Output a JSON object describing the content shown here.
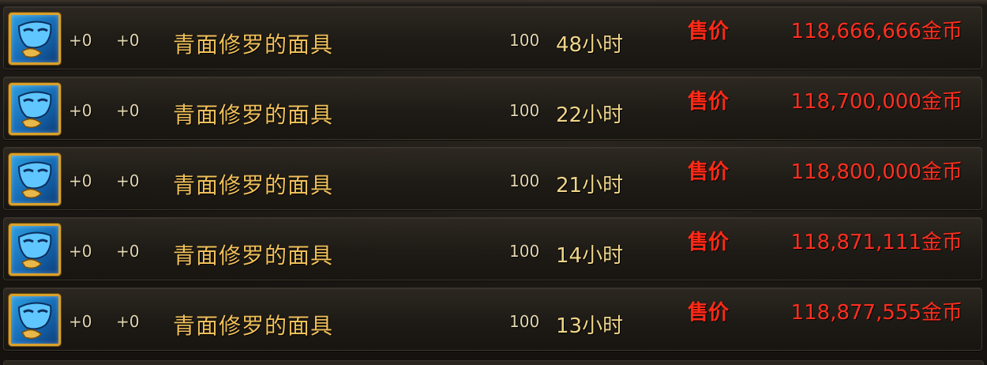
{
  "listings": [
    {
      "plus1": "+0",
      "plus2": "+0",
      "name": "青面修罗的面具",
      "level": "100",
      "time_left": "48小时",
      "sell_label": "售价",
      "price": "118,666,666金币",
      "icon": "blue-mask-icon"
    },
    {
      "plus1": "+0",
      "plus2": "+0",
      "name": "青面修罗的面具",
      "level": "100",
      "time_left": "22小时",
      "sell_label": "售价",
      "price": "118,700,000金币",
      "icon": "blue-mask-icon"
    },
    {
      "plus1": "+0",
      "plus2": "+0",
      "name": "青面修罗的面具",
      "level": "100",
      "time_left": "21小时",
      "sell_label": "售价",
      "price": "118,800,000金币",
      "icon": "blue-mask-icon"
    },
    {
      "plus1": "+0",
      "plus2": "+0",
      "name": "青面修罗的面具",
      "level": "100",
      "time_left": "14小时",
      "sell_label": "售价",
      "price": "118,871,111金币",
      "icon": "blue-mask-icon"
    },
    {
      "plus1": "+0",
      "plus2": "+0",
      "name": "青面修罗的面具",
      "level": "100",
      "time_left": "13小时",
      "sell_label": "售价",
      "price": "118,877,555金币",
      "icon": "blue-mask-icon"
    }
  ],
  "colors": {
    "item_name": "#f0c05a",
    "price_red": "#ff2f1f",
    "icon_border": "#d9a12b",
    "icon_blue": "#1f86d0"
  }
}
